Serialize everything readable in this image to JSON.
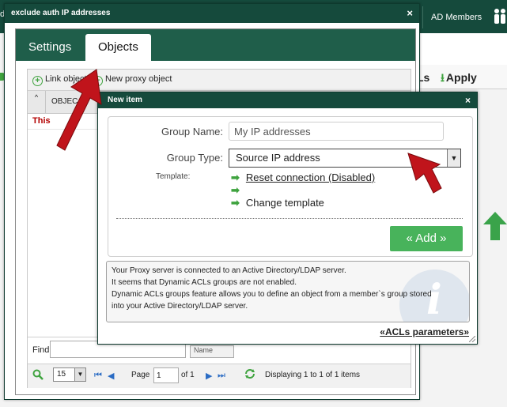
{
  "app": {
    "header_fragment": "d",
    "ad_members_label": "AD Members",
    "acls_fragment": "Ls",
    "apply_label": "Apply"
  },
  "outer_dialog": {
    "title": "exclude auth IP addresses",
    "close_symbol": "×",
    "tabs": [
      {
        "label": "Settings",
        "active": false
      },
      {
        "label": "Objects",
        "active": true
      }
    ],
    "toolbar": {
      "link_object_label": "Link object",
      "new_proxy_object_label": "New proxy object"
    },
    "grid": {
      "column_header": "OBJEC",
      "row_text": "This"
    },
    "find": {
      "label": "Find",
      "value": "",
      "select_fragment": "Name"
    },
    "pager": {
      "page_size": "15",
      "page_label": "Page",
      "page_value": "1",
      "of_label": "of 1",
      "display_text": "Displaying 1 to 1 of 1 items"
    }
  },
  "new_item_dialog": {
    "title": "New item",
    "close_symbol": "×",
    "group_name_label": "Group Name:",
    "group_name_placeholder": "My IP addresses",
    "group_type_label": "Group Type:",
    "group_type_value": "Source IP address",
    "template_label": "Template:",
    "template_items": [
      "Reset connection (Disabled)",
      "",
      "Change template"
    ],
    "add_button_label": "« Add »",
    "info_lines": [
      "Your Proxy server is connected to an Active Directory/LDAP server.",
      "It seems that Dynamic ACLs groups are not enabled.",
      "Dynamic ACLs groups feature allows you to define an object from a member`s group stored",
      "into your Active Directory/LDAP server."
    ],
    "acls_params_link": "«ACLs parameters»"
  },
  "colors": {
    "header_green": "#154a3c",
    "tab_green": "#1f5e4a",
    "add_button_green": "#48b35b",
    "icon_green": "#3fa33f",
    "annotation_red": "#c0141b"
  }
}
